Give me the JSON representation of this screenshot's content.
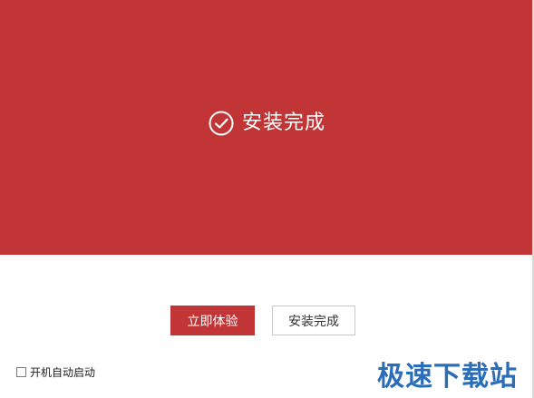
{
  "hero": {
    "icon": "check-circle-icon",
    "title": "安装完成",
    "background": "#c13536"
  },
  "actions": {
    "primary_label": "立即体验",
    "secondary_label": "安装完成"
  },
  "options": {
    "autostart_label": "开机自动启动",
    "autostart_checked": false
  },
  "watermark": {
    "text": "极速下载站"
  }
}
